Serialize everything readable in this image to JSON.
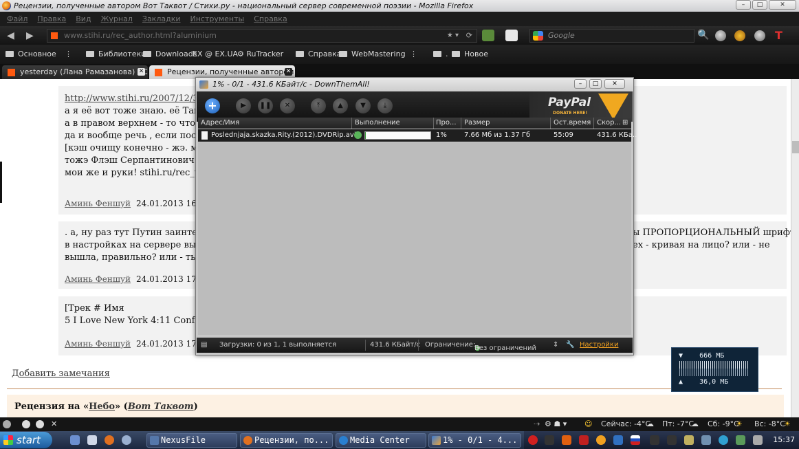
{
  "window": {
    "title": "Рецензии, полученные автором Вот Таквот / Стихи.ру - национальный сервер современной поэзии - Mozilla Firefox",
    "controls": [
      "–",
      "□",
      "✕"
    ]
  },
  "menu": [
    "Файл",
    "Правка",
    "Вид",
    "Журнал",
    "Закладки",
    "Инструменты",
    "Справка"
  ],
  "navbar": {
    "back": "◀",
    "forward": "▶",
    "url": "www.stihi.ru/rec_author.html?aluminium",
    "search_placeholder": "Google"
  },
  "bookmarks": [
    {
      "label": "Основное",
      "icon": "folder"
    },
    {
      "label": "Библиотеки",
      "icon": "folder"
    },
    {
      "label": "Downloads",
      "icon": "folder"
    },
    {
      "label": "EX @ EX.UA",
      "icon": "ex-ua"
    },
    {
      "label": "RuTracker",
      "icon": "rutracker"
    },
    {
      "label": "Справка",
      "icon": "folder"
    },
    {
      "label": "WebMastering",
      "icon": "folder"
    },
    {
      "label": ".",
      "icon": "folder"
    },
    {
      "label": "Новое",
      "icon": "folder"
    }
  ],
  "tabs": [
    {
      "label": "yesterday (Лана Рамазанова) / Сти...",
      "active": false
    },
    {
      "label": "Рецензии, полученные автором В...",
      "active": true
    }
  ],
  "page": {
    "comments": [
      {
        "lines": [
          "http://www.stihi.ru/2007/12/30/1",
          "а я её вот тоже знаю. её Таней з",
          "а в правом верхнем - то что-то",
          "да и вообще речь , если послуш",
          "[кэш очищу конечно - жэ. мои ж",
          "тожэ Флэш Серпантинович. пос",
          "",
          "мои же и руки! stihi.ru/rec_write"
        ],
        "author": "Аминь Феншуй",
        "date": "24.01.2013 16:54",
        "trail": "3"
      },
      {
        "lines": [
          ". а, ну раз тут Путин заинтересо",
          "в настройках на сервере выстав",
          "вышла, правильно? или - ты лут"
        ],
        "right_lines": [
          "ы ПРОПОРЦИОНАЛЬНЫЙ шрифт",
          "ех - кривая на лицо? или - не"
        ],
        "author": "Аминь Феншуй",
        "date": "24.01.2013 17:18",
        "trail": "3"
      },
      {
        "lines": [
          "[Трек # Имя",
          "5 I Love New York 4:11 Confess"
        ],
        "author": "Аминь Феншуй",
        "date": "24.01.2013 17:18",
        "trail": "3"
      }
    ],
    "add_remarks": "Добавить замечания",
    "review": {
      "prefix": "Рецензия на «",
      "work": "Небо",
      "middle": "» (",
      "author": "Вот Таквот",
      "suffix": ")"
    }
  },
  "dta": {
    "title": "1% - 0/1 - 431.6 КБайт/с - DownThemAll!",
    "paypal": {
      "brand": "PayPal",
      "tagline": "DONATE HERE!"
    },
    "columns": [
      "Адрес/Имя",
      "Выполнение",
      "Про...",
      "Размер",
      "Ост.время",
      "Скор..."
    ],
    "download": {
      "name": "Poslednjaja.skazka.Rity.(2012).DVDRip.avi",
      "percent": "1%",
      "progress": 0.01,
      "size": "7.66 Мб из 1.37 Гб",
      "remaining": "55:09",
      "speed": "431.6 КБа..."
    },
    "status": {
      "downloads": "Загрузки: 0 из 1, 1 выполняется",
      "speed": "431.6 КБайт/с",
      "limit_label": "Ограничение:",
      "limit_value": "Без ограничений",
      "settings": "Настройки"
    }
  },
  "memwidget": {
    "top": "666 МБ",
    "bottom": "36,0 МБ"
  },
  "statusbar": {
    "weather": [
      "Сейчас: -4°C",
      "Пт: -7°C",
      "Сб: -9°C",
      "Вс: -8°C"
    ]
  },
  "taskbar": {
    "start": "start",
    "tasks": [
      {
        "label": "NexusFile",
        "color": "#5577aa"
      },
      {
        "label": "Рецензии, по...",
        "color": "#e07020"
      },
      {
        "label": "Media Center",
        "color": "#2a7fd0"
      },
      {
        "label": "1% - 0/1 - 4...",
        "color": "#3a7bd5"
      }
    ],
    "clock": "15:37"
  }
}
